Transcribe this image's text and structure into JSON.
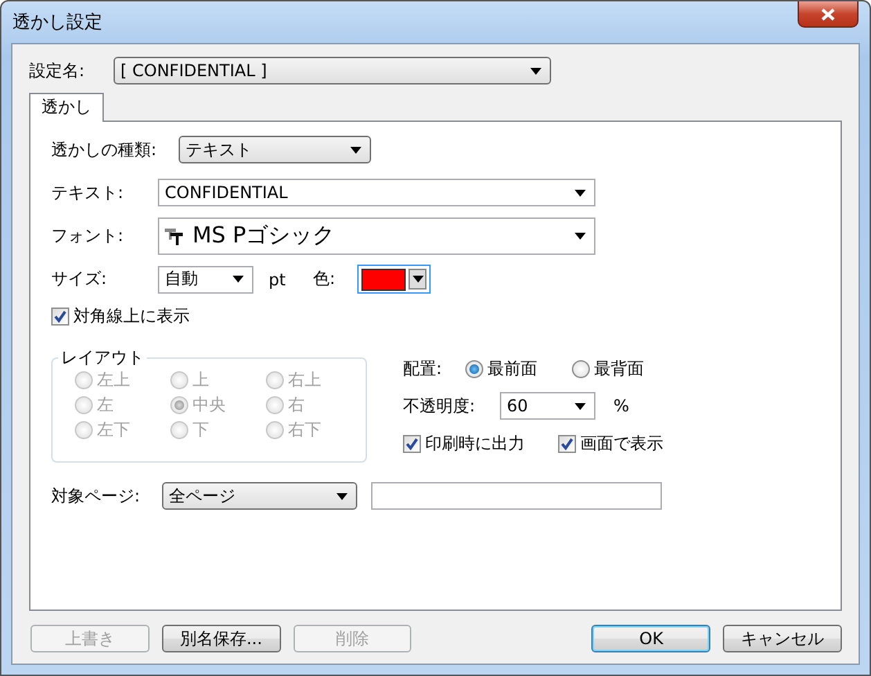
{
  "window": {
    "title": "透かし設定"
  },
  "setting_name": {
    "label": "設定名:",
    "value": "[ CONFIDENTIAL ]"
  },
  "tabs": [
    {
      "label": "透かし",
      "selected": true
    }
  ],
  "watermark_type": {
    "label": "透かしの種類:",
    "value": "テキスト"
  },
  "text": {
    "label": "テキスト:",
    "value": "CONFIDENTIAL"
  },
  "font": {
    "label": "フォント:",
    "value": "MS Pゴシック"
  },
  "size": {
    "label": "サイズ:",
    "value": "自動",
    "unit": "pt"
  },
  "color": {
    "label": "色:",
    "color": "#ff0000"
  },
  "diagonal": {
    "label": "対角線上に表示",
    "checked": true
  },
  "layout": {
    "title": "レイアウト",
    "disabled": true,
    "options": [
      {
        "label": "左上",
        "selected": false
      },
      {
        "label": "上",
        "selected": false
      },
      {
        "label": "右上",
        "selected": false
      },
      {
        "label": "左",
        "selected": false
      },
      {
        "label": "中央",
        "selected": true
      },
      {
        "label": "右",
        "selected": false
      },
      {
        "label": "左下",
        "selected": false
      },
      {
        "label": "下",
        "selected": false
      },
      {
        "label": "右下",
        "selected": false
      }
    ]
  },
  "placement": {
    "label": "配置:",
    "options": [
      {
        "label": "最前面",
        "selected": true
      },
      {
        "label": "最背面",
        "selected": false
      }
    ]
  },
  "opacity": {
    "label": "不透明度:",
    "value": "60",
    "unit": "%"
  },
  "print_output": {
    "label": "印刷時に出力",
    "checked": true
  },
  "screen_display": {
    "label": "画面で表示",
    "checked": true
  },
  "target_page": {
    "label": "対象ページ:",
    "value": "全ページ"
  },
  "buttons": [
    {
      "label": "上書き",
      "disabled": true,
      "default": false
    },
    {
      "label": "別名保存...",
      "disabled": false,
      "default": false
    },
    {
      "label": "削除",
      "disabled": true,
      "default": false
    },
    {
      "label": "OK",
      "disabled": false,
      "default": true
    },
    {
      "label": "キャンセル",
      "disabled": false,
      "default": false
    }
  ]
}
